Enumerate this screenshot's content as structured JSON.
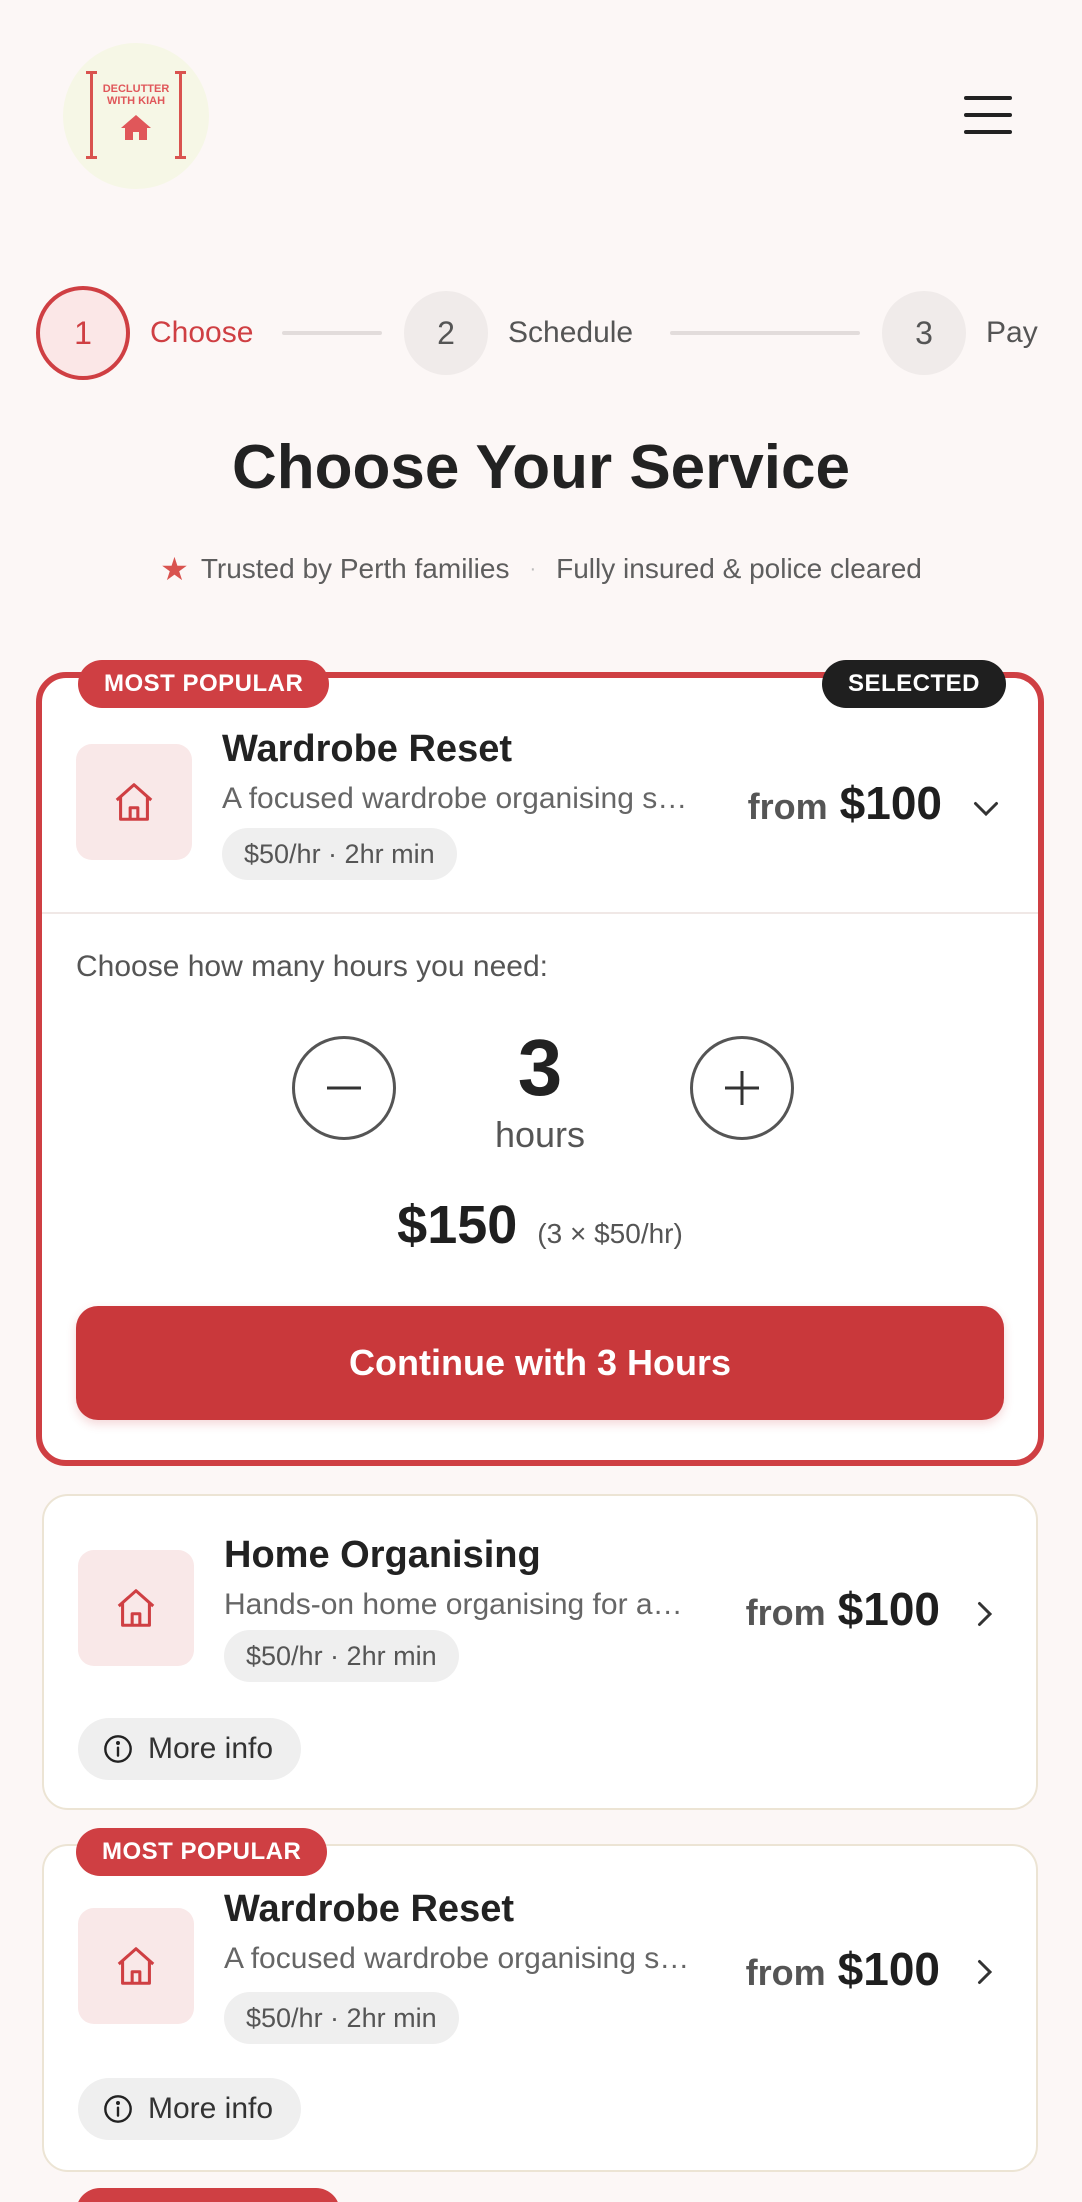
{
  "brand": {
    "logo_text": "DECLUTTER WITH KIAH"
  },
  "steps": [
    {
      "number": "1",
      "label": "Choose"
    },
    {
      "number": "2",
      "label": "Schedule"
    },
    {
      "number": "3",
      "label": "Pay"
    }
  ],
  "page_title": "Choose Your Service",
  "trust": {
    "item1": "Trusted by Perth families",
    "separator": "·",
    "item2": "Fully insured & police cleared"
  },
  "colors": {
    "accent": "#cf3f43",
    "background": "#fcf7f6",
    "selected_badge": "#1f1f1f"
  },
  "services": [
    {
      "badge": "MOST POPULAR",
      "selected_label": "SELECTED",
      "name": "Wardrobe Reset",
      "description": "A focused wardrobe organising session",
      "tag": "$50/hr · 2hr min",
      "from_label": "from",
      "price": "$100",
      "icon": "house-icon"
    },
    {
      "name": "Home Organising",
      "description": "Hands-on home organising for any room",
      "tag": "$50/hr · 2hr min",
      "from_label": "from",
      "price": "$100",
      "more_info": "More info",
      "icon": "house-icon"
    },
    {
      "badge": "MOST POPULAR",
      "name": "Wardrobe Reset",
      "description": "A focused wardrobe organising session",
      "tag": "$50/hr · 2hr min",
      "from_label": "from",
      "price": "$100",
      "more_info": "More info",
      "icon": "house-icon"
    }
  ],
  "hours": {
    "prompt": "Choose how many hours you need:",
    "value": "3",
    "unit": "hours",
    "total": "$150",
    "calculation": "(3 × $50/hr)",
    "continue_label": "Continue with 3 Hours"
  }
}
